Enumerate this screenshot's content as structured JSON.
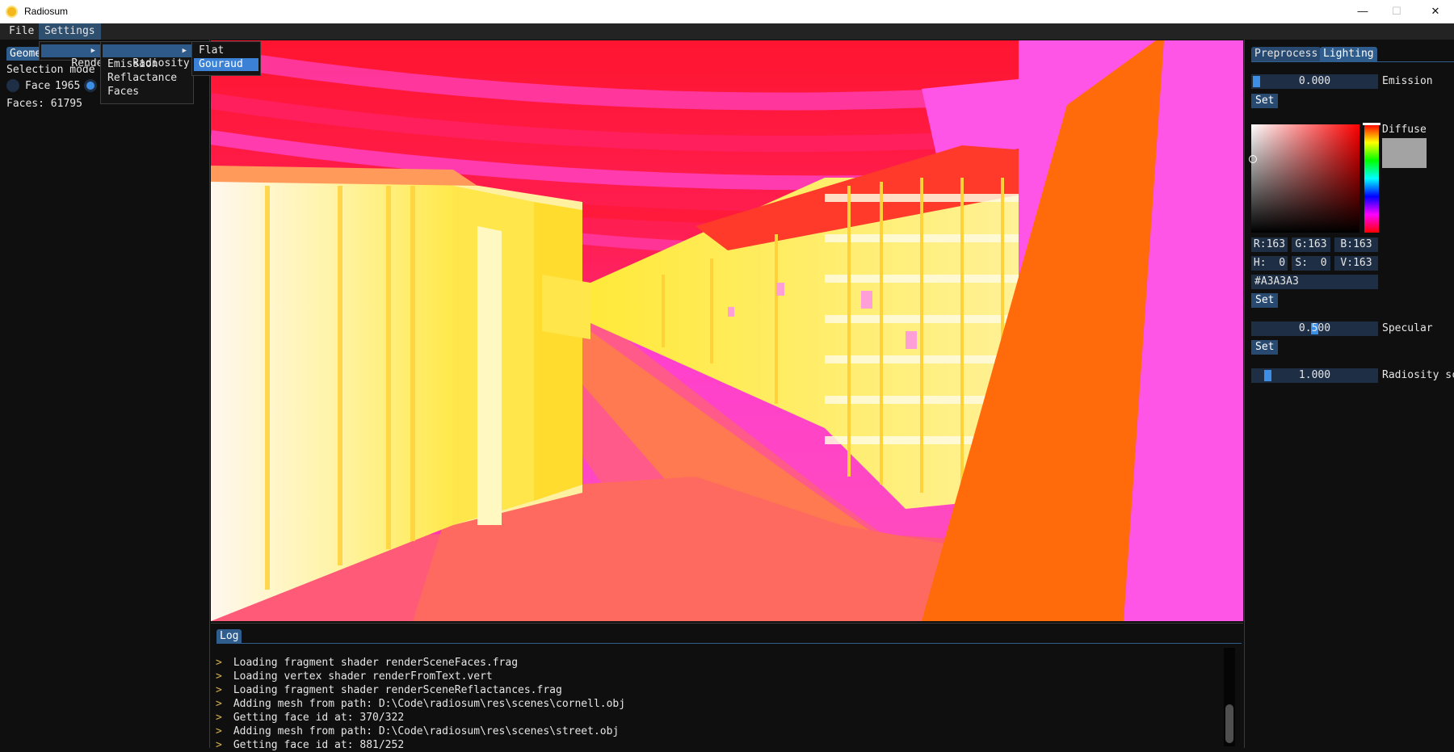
{
  "window": {
    "title": "Radiosum",
    "minimize": "—",
    "maximize": "☐",
    "close": "✕"
  },
  "menubar": {
    "file": "File",
    "settings": "Settings"
  },
  "menus": {
    "settings_items": [
      "Render"
    ],
    "render_items": [
      "Radiosity",
      "Emission",
      "Reflactance",
      "Faces"
    ],
    "radiosity_items": [
      "Flat",
      "Gouraud"
    ],
    "selected_shading": "Gouraud"
  },
  "left_panel": {
    "tab": "Geome",
    "selection_mode_label": "Selection mode",
    "radio_face_label": "Face",
    "face_value": "1965",
    "faces_count": "Faces: 61795"
  },
  "right_panel": {
    "tabs": [
      "Preprocess",
      "Lighting"
    ],
    "active_tab": "Lighting",
    "emission": {
      "value": "0.000",
      "label": "Emission",
      "fraction": 0.0
    },
    "set_label": "Set",
    "diffuse": {
      "label": "Diffuse",
      "swatch_color": "#A3A3A3",
      "r": "R:163",
      "g": "G:163",
      "b": "B:163",
      "h": "H:  0",
      "s": "S:  0",
      "v": "V:163",
      "hex": "#A3A3A3"
    },
    "specular": {
      "value": "0.500",
      "label": "Specular",
      "fraction": 0.5
    },
    "radiosity_scale": {
      "value": "1.000",
      "label": "Radiosity sc",
      "fraction": 0.1
    }
  },
  "log": {
    "tab": "Log",
    "chevron": ">",
    "lines": [
      "Loading fragment shader renderSceneFaces.frag",
      "Loading vertex shader renderFromText.vert",
      "Loading fragment shader renderSceneReflactances.frag",
      "Adding mesh from path: D:\\Code\\radiosum\\res\\scenes\\cornell.obj",
      "Getting face id at: 370/322",
      "Adding mesh from path: D:\\Code\\radiosum\\res\\scenes\\street.obj",
      "Getting face id at: 881/252"
    ]
  },
  "colors": {
    "accent": "#3d8ee5",
    "tab_active": "#2f5d8e",
    "frame_bg": "#1e2e44",
    "log_chevron": "#d8b34a",
    "scene_sky_red": "#ff1a33",
    "scene_magenta": "#ff33cc",
    "scene_yellow": "#ffee44",
    "scene_orange": "#ff6a0a"
  }
}
